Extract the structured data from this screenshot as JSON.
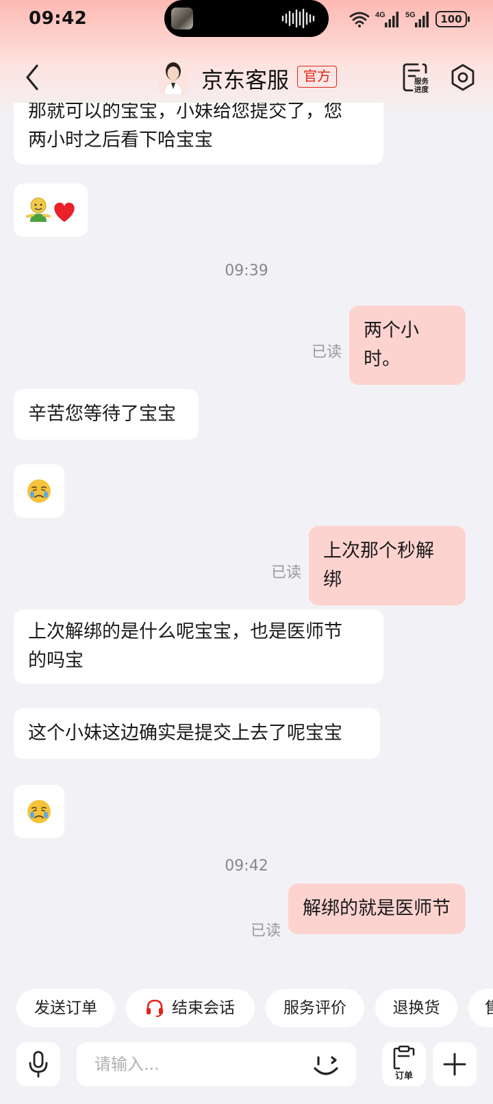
{
  "status_bar": {
    "time": "09:42",
    "network_1": "4G",
    "network_2": "5G",
    "battery": "100"
  },
  "nav": {
    "title": "京东客服",
    "badge": "官方",
    "service_label_line1": "服务",
    "service_label_line2": "进度"
  },
  "messages": {
    "m1": "那就可以的宝宝，小妹给您提交了，您两小时之后看下哈宝宝",
    "m1_line1": "那就可以的宝宝，小妹给您提交了，您",
    "m1_line2": "两小时之后看下哈宝宝",
    "ts1": "09:39",
    "m3": "两个小时。",
    "read": "已读",
    "m4": "辛苦您等待了宝宝",
    "m6": "上次那个秒解绑",
    "m7_line1": "上次解绑的是什么呢宝宝，也是医师节",
    "m7_line2": "的吗宝",
    "m8": "这个小妹这边确实是提交上去了呢宝宝",
    "ts2": "09:42",
    "m10": "解绑的就是医师节"
  },
  "quick_actions": [
    "发送订单",
    "结束会话",
    "服务评价",
    "退换货",
    "售"
  ],
  "input": {
    "placeholder": "请输入...",
    "order_label": "订单"
  },
  "colors": {
    "accent_red": "#e2231a",
    "outgoing_bubble": "#fdd3d0",
    "incoming_bubble": "#ffffff"
  }
}
